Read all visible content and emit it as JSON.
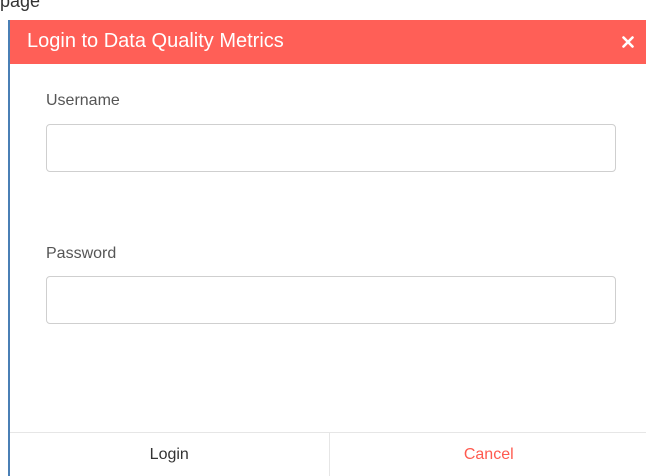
{
  "page": {
    "partial_text": "page"
  },
  "dialog": {
    "title": "Login to Data Quality Metrics",
    "close_icon": "close-icon",
    "header_color": "#ff5f57"
  },
  "form": {
    "username": {
      "label": "Username",
      "value": "",
      "placeholder": ""
    },
    "password": {
      "label": "Password",
      "value": "",
      "placeholder": ""
    }
  },
  "footer": {
    "login_label": "Login",
    "cancel_label": "Cancel",
    "cancel_color": "#ff5a4f"
  }
}
